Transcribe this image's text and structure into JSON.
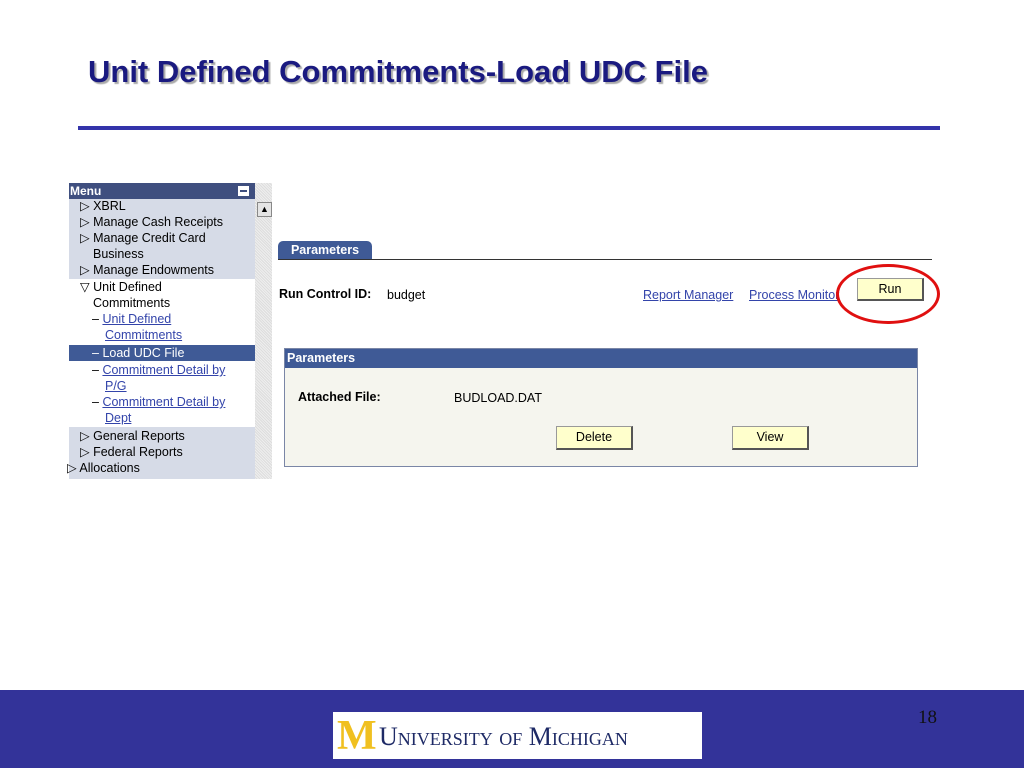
{
  "slide": {
    "title": "Unit Defined Commitments-Load UDC File",
    "page_number": "18",
    "logo_text": "University of Michigan",
    "logo_mark": "M"
  },
  "menu": {
    "title": "Menu",
    "items": [
      {
        "label": "XBRL"
      },
      {
        "label": "Manage Cash Receipts"
      },
      {
        "label": "Manage Credit Card"
      },
      {
        "label": "Business"
      },
      {
        "label": "Manage Endowments"
      },
      {
        "label": "Unit Defined"
      },
      {
        "label": "Commitments"
      },
      {
        "label": "Unit Defined"
      },
      {
        "label": "Commitments"
      },
      {
        "label": "Load UDC File"
      },
      {
        "label": "Commitment Detail by"
      },
      {
        "label": "P/G"
      },
      {
        "label": "Commitment Detail by"
      },
      {
        "label": "Dept"
      },
      {
        "label": "General Reports"
      },
      {
        "label": "Federal Reports"
      },
      {
        "label": "Allocations"
      }
    ]
  },
  "page": {
    "tab": "Parameters",
    "run_control_label": "Run Control ID:",
    "run_control_value": "budget",
    "report_manager": "Report Manager",
    "process_monitor": "Process Monitor",
    "run": "Run",
    "section_title": "Parameters",
    "attached_label": "Attached File:",
    "attached_value": "BUDLOAD.DAT",
    "delete": "Delete",
    "view": "View"
  },
  "colors": {
    "footer": "#333399",
    "header_blue": "#3f5a96",
    "highlight_oval": "#e01010",
    "button": "#ffffcc"
  }
}
